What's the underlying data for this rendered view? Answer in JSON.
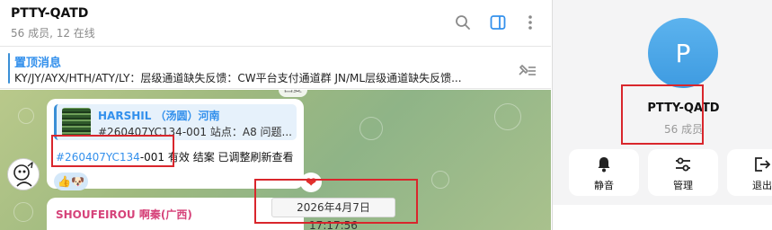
{
  "chat": {
    "title": "PTTY-QATD",
    "subtitle": "56 成员, 12 在线",
    "pinned": {
      "title": "置顶消息",
      "text": "KY/JY/AYX/HTH/ATY/LY：层级通道缺失反馈：CW平台支付通道群 JN/ML层级通道缺失反馈..."
    },
    "reply_pill": "回复",
    "message": {
      "quote_sender": "HARSHIL （汤圆）河南",
      "quote_text": "#260407YC134-001 站点：A8 问题...",
      "hashtag": "#260407YC134",
      "text_rest": "-001 有效 结案 已调整刷新查看",
      "reaction": "👍🐶",
      "time": "17:17",
      "heart": "❤"
    },
    "date_tooltip": "2026年4月7日 17:17:56",
    "next_sender": "SHOUFEIROU 啊秦(广西)"
  },
  "profile": {
    "avatar_letter": "P",
    "name": "PTTY-QATD",
    "members": "56 成员",
    "actions": [
      {
        "label": "静音",
        "icon": "bell-icon"
      },
      {
        "label": "管理",
        "icon": "sliders-icon"
      },
      {
        "label": "退出",
        "icon": "exit-icon"
      }
    ]
  },
  "colors": {
    "accent": "#3390ec",
    "highlight_box": "#d9262c",
    "avatar": "#4aa6e8"
  }
}
